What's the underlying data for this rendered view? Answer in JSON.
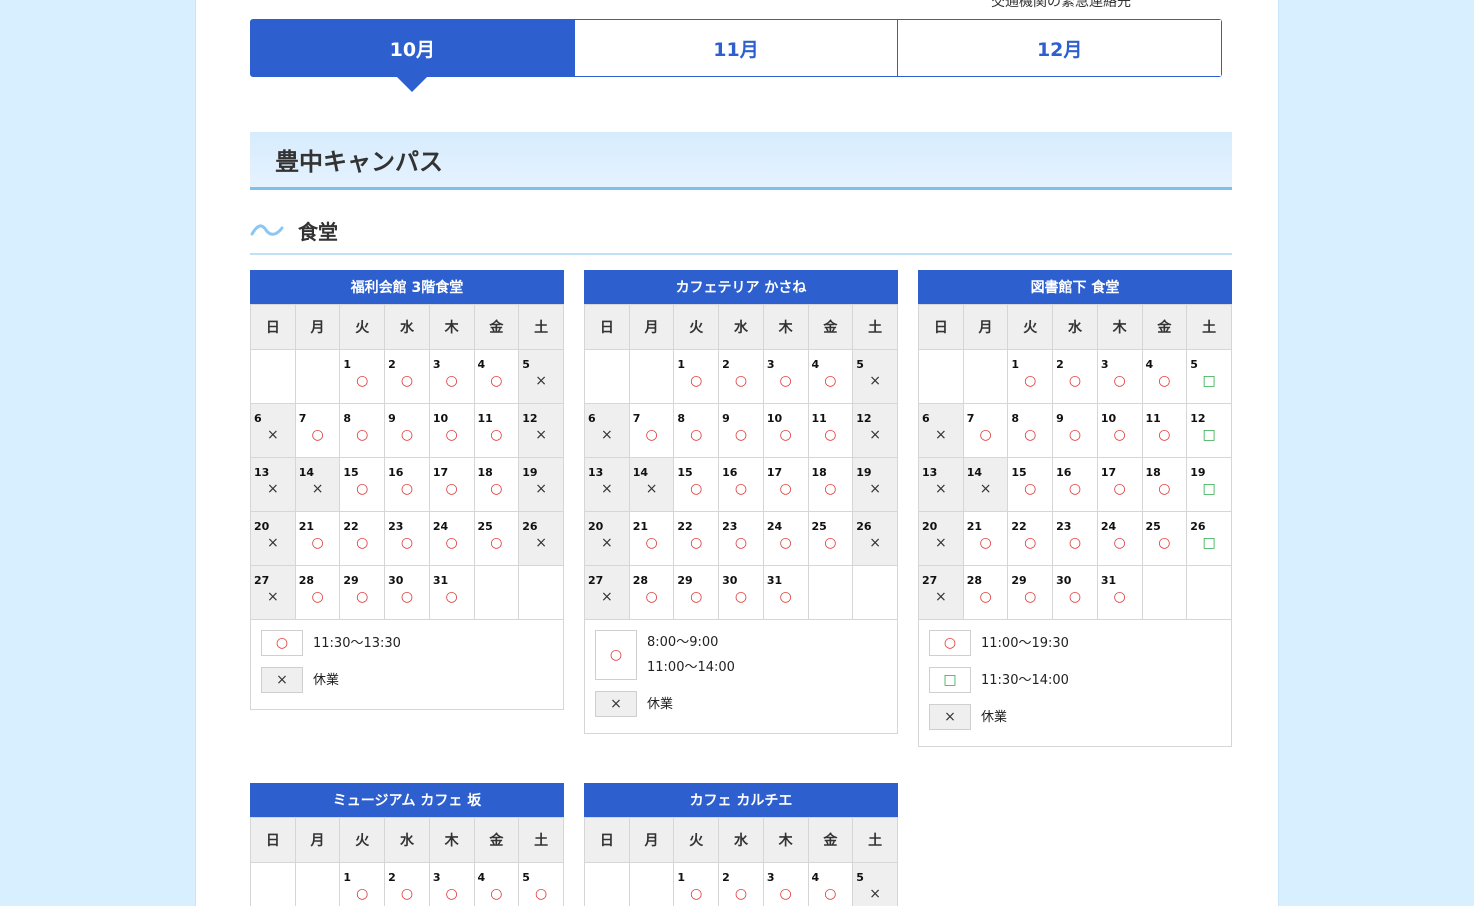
{
  "header": {
    "top_link": "交通機関の緊急連絡先"
  },
  "month_tabs": [
    {
      "label": "10月",
      "active": true
    },
    {
      "label": "11月",
      "active": false
    },
    {
      "label": "12月",
      "active": false
    }
  ],
  "campus": {
    "title": "豊中キャンパス",
    "section_title": "食堂"
  },
  "weekdays": [
    "日",
    "月",
    "火",
    "水",
    "木",
    "金",
    "土"
  ],
  "calendars": [
    {
      "title": "福利会館 3階食堂",
      "weeks": [
        [
          null,
          null,
          {
            "d": "1",
            "m": "○"
          },
          {
            "d": "2",
            "m": "○"
          },
          {
            "d": "3",
            "m": "○"
          },
          {
            "d": "4",
            "m": "○"
          },
          {
            "d": "5",
            "m": "×"
          }
        ],
        [
          {
            "d": "6",
            "m": "×"
          },
          {
            "d": "7",
            "m": "○"
          },
          {
            "d": "8",
            "m": "○"
          },
          {
            "d": "9",
            "m": "○"
          },
          {
            "d": "10",
            "m": "○"
          },
          {
            "d": "11",
            "m": "○"
          },
          {
            "d": "12",
            "m": "×"
          }
        ],
        [
          {
            "d": "13",
            "m": "×"
          },
          {
            "d": "14",
            "m": "×"
          },
          {
            "d": "15",
            "m": "○"
          },
          {
            "d": "16",
            "m": "○"
          },
          {
            "d": "17",
            "m": "○"
          },
          {
            "d": "18",
            "m": "○"
          },
          {
            "d": "19",
            "m": "×"
          }
        ],
        [
          {
            "d": "20",
            "m": "×"
          },
          {
            "d": "21",
            "m": "○"
          },
          {
            "d": "22",
            "m": "○"
          },
          {
            "d": "23",
            "m": "○"
          },
          {
            "d": "24",
            "m": "○"
          },
          {
            "d": "25",
            "m": "○"
          },
          {
            "d": "26",
            "m": "×"
          }
        ],
        [
          {
            "d": "27",
            "m": "×"
          },
          {
            "d": "28",
            "m": "○"
          },
          {
            "d": "29",
            "m": "○"
          },
          {
            "d": "30",
            "m": "○"
          },
          {
            "d": "31",
            "m": "○"
          },
          null,
          null
        ]
      ],
      "legend": [
        {
          "mark": "○",
          "lines": [
            "11:30〜13:30"
          ]
        },
        {
          "mark": "×",
          "lines": [
            "休業"
          ]
        }
      ]
    },
    {
      "title": "カフェテリア かさね",
      "weeks": [
        [
          null,
          null,
          {
            "d": "1",
            "m": "○"
          },
          {
            "d": "2",
            "m": "○"
          },
          {
            "d": "3",
            "m": "○"
          },
          {
            "d": "4",
            "m": "○"
          },
          {
            "d": "5",
            "m": "×"
          }
        ],
        [
          {
            "d": "6",
            "m": "×"
          },
          {
            "d": "7",
            "m": "○"
          },
          {
            "d": "8",
            "m": "○"
          },
          {
            "d": "9",
            "m": "○"
          },
          {
            "d": "10",
            "m": "○"
          },
          {
            "d": "11",
            "m": "○"
          },
          {
            "d": "12",
            "m": "×"
          }
        ],
        [
          {
            "d": "13",
            "m": "×"
          },
          {
            "d": "14",
            "m": "×"
          },
          {
            "d": "15",
            "m": "○"
          },
          {
            "d": "16",
            "m": "○"
          },
          {
            "d": "17",
            "m": "○"
          },
          {
            "d": "18",
            "m": "○"
          },
          {
            "d": "19",
            "m": "×"
          }
        ],
        [
          {
            "d": "20",
            "m": "×"
          },
          {
            "d": "21",
            "m": "○"
          },
          {
            "d": "22",
            "m": "○"
          },
          {
            "d": "23",
            "m": "○"
          },
          {
            "d": "24",
            "m": "○"
          },
          {
            "d": "25",
            "m": "○"
          },
          {
            "d": "26",
            "m": "×"
          }
        ],
        [
          {
            "d": "27",
            "m": "×"
          },
          {
            "d": "28",
            "m": "○"
          },
          {
            "d": "29",
            "m": "○"
          },
          {
            "d": "30",
            "m": "○"
          },
          {
            "d": "31",
            "m": "○"
          },
          null,
          null
        ]
      ],
      "legend": [
        {
          "mark": "○",
          "lines": [
            "8:00〜9:00",
            "11:00〜14:00"
          ]
        },
        {
          "mark": "×",
          "lines": [
            "休業"
          ]
        }
      ]
    },
    {
      "title": "図書館下 食堂",
      "weeks": [
        [
          null,
          null,
          {
            "d": "1",
            "m": "○"
          },
          {
            "d": "2",
            "m": "○"
          },
          {
            "d": "3",
            "m": "○"
          },
          {
            "d": "4",
            "m": "○"
          },
          {
            "d": "5",
            "m": "□"
          }
        ],
        [
          {
            "d": "6",
            "m": "×"
          },
          {
            "d": "7",
            "m": "○"
          },
          {
            "d": "8",
            "m": "○"
          },
          {
            "d": "9",
            "m": "○"
          },
          {
            "d": "10",
            "m": "○"
          },
          {
            "d": "11",
            "m": "○"
          },
          {
            "d": "12",
            "m": "□"
          }
        ],
        [
          {
            "d": "13",
            "m": "×"
          },
          {
            "d": "14",
            "m": "×"
          },
          {
            "d": "15",
            "m": "○"
          },
          {
            "d": "16",
            "m": "○"
          },
          {
            "d": "17",
            "m": "○"
          },
          {
            "d": "18",
            "m": "○"
          },
          {
            "d": "19",
            "m": "□"
          }
        ],
        [
          {
            "d": "20",
            "m": "×"
          },
          {
            "d": "21",
            "m": "○"
          },
          {
            "d": "22",
            "m": "○"
          },
          {
            "d": "23",
            "m": "○"
          },
          {
            "d": "24",
            "m": "○"
          },
          {
            "d": "25",
            "m": "○"
          },
          {
            "d": "26",
            "m": "□"
          }
        ],
        [
          {
            "d": "27",
            "m": "×"
          },
          {
            "d": "28",
            "m": "○"
          },
          {
            "d": "29",
            "m": "○"
          },
          {
            "d": "30",
            "m": "○"
          },
          {
            "d": "31",
            "m": "○"
          },
          null,
          null
        ]
      ],
      "legend": [
        {
          "mark": "○",
          "lines": [
            "11:00〜19:30"
          ]
        },
        {
          "mark": "□",
          "lines": [
            "11:30〜14:00"
          ]
        },
        {
          "mark": "×",
          "lines": [
            "休業"
          ]
        }
      ]
    },
    {
      "title": "ミュージアム カフェ 坂",
      "weeks": [
        [
          null,
          null,
          {
            "d": "1",
            "m": "○"
          },
          {
            "d": "2",
            "m": "○"
          },
          {
            "d": "3",
            "m": "○"
          },
          {
            "d": "4",
            "m": "○"
          },
          {
            "d": "5",
            "m": "○"
          }
        ]
      ],
      "legend": []
    },
    {
      "title": "カフェ カルチエ",
      "weeks": [
        [
          null,
          null,
          {
            "d": "1",
            "m": "○"
          },
          {
            "d": "2",
            "m": "○"
          },
          {
            "d": "3",
            "m": "○"
          },
          {
            "d": "4",
            "m": "○"
          },
          {
            "d": "5",
            "m": "×"
          }
        ]
      ],
      "legend": []
    }
  ],
  "colors": {
    "primary": "#2d5fcf",
    "open_mark": "#e23a3a",
    "alt_mark": "#2cab4a",
    "closed_bg": "#efefef",
    "page_bg": "#d7efff"
  }
}
